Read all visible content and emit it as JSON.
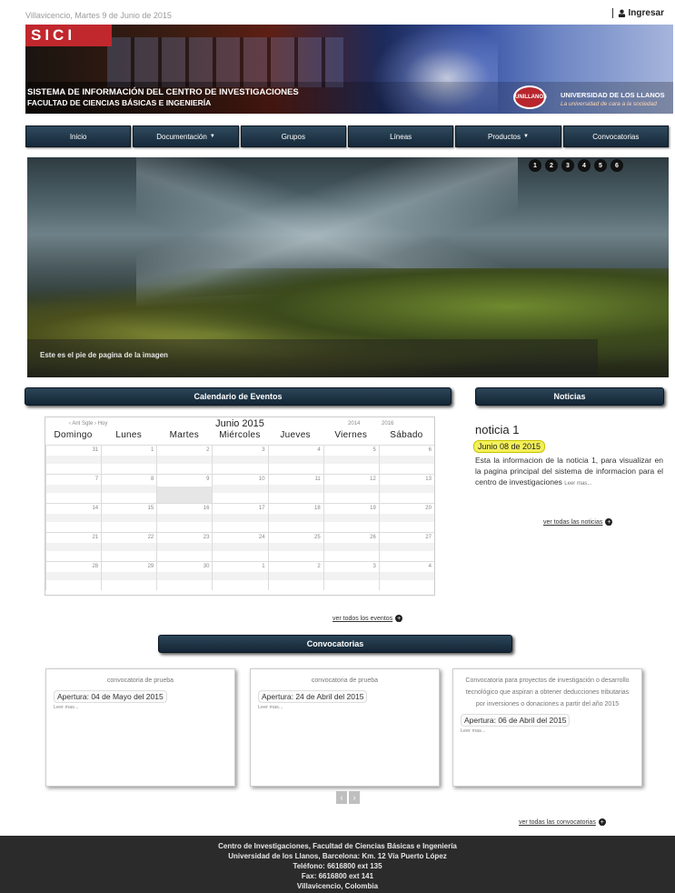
{
  "topbar": {
    "date": "Villavicencio, Martes 9 de Junio de 2015",
    "login_label": "Ingresar"
  },
  "banner": {
    "logo": "SICI",
    "title_line1": "SISTEMA DE INFORMACIÓN DEL CENTRO DE INVESTIGACIONES",
    "title_line2": "FACULTAD DE CIENCIAS BÁSICAS E INGENIERÍA",
    "university": "UNIVERSIDAD DE LOS LLANOS",
    "slogan": "La universidad de cara a la sociedad"
  },
  "nav": {
    "items": [
      {
        "label": "Inicio",
        "dropdown": false
      },
      {
        "label": "Documentación",
        "dropdown": true
      },
      {
        "label": "Grupos",
        "dropdown": false
      },
      {
        "label": "Líneas",
        "dropdown": false
      },
      {
        "label": "Productos",
        "dropdown": true
      },
      {
        "label": "Convocatorias",
        "dropdown": false
      }
    ]
  },
  "slider": {
    "caption": "Este es el pie de pagina de la imagen",
    "pages": [
      "1",
      "2",
      "3",
      "4",
      "5",
      "6"
    ]
  },
  "calendar": {
    "section_title": "Calendario de Eventos",
    "nav": "‹ Ant  Sgte › Hoy",
    "month_title": "Junio 2015",
    "year_prev": "2014",
    "year_next": "2016",
    "weekdays": [
      "Domingo",
      "Lunes",
      "Martes",
      "Miércoles",
      "Jueves",
      "Viernes",
      "Sábado"
    ],
    "days": [
      "31",
      "1",
      "2",
      "3",
      "4",
      "5",
      "6",
      "7",
      "8",
      "9",
      "10",
      "11",
      "12",
      "13",
      "14",
      "15",
      "16",
      "17",
      "18",
      "19",
      "20",
      "21",
      "22",
      "23",
      "24",
      "25",
      "26",
      "27",
      "28",
      "29",
      "30",
      "1",
      "2",
      "3",
      "4"
    ],
    "see_all": "ver todos los eventos"
  },
  "news": {
    "section_title": "Noticias",
    "title": "noticia 1",
    "date": "Junio 08 de 2015",
    "body": "Esta la informacion de la noticia 1, para visualizar en la pagina principal del sistema de informacion para el centro de investigaciones",
    "read_more": "Leer mas...",
    "see_all": "ver todas las noticias"
  },
  "convocatorias": {
    "section_title": "Convocatorias",
    "cards": [
      {
        "title": "convocatoria de prueba",
        "opening": "Apertura: 04 de Mayo del 2015",
        "read_more": "Leer mas..."
      },
      {
        "title": "convocatoria de prueba",
        "opening": "Apertura: 24 de Abril del 2015",
        "read_more": "Leer mas..."
      },
      {
        "title": "Convocatoria para proyectos de investigación o desarrollo tecnológico que aspiran a obtener deducciones tributarias por inversiones o donaciones a partir del año 2015",
        "opening": "Apertura: 06 de Abril del 2015",
        "read_more": "Leer mas..."
      }
    ],
    "prev_glyph": "‹",
    "next_glyph": "›",
    "see_all": "ver todas las convocatorias"
  },
  "footer": {
    "lines": [
      "Centro de Investigaciones, Facultad de Ciencias Básicas e Ingeniería",
      "Universidad de los Llanos, Barcelona: Km. 12 Vía Puerto López",
      "Teléfono: 6616800 ext 135",
      "Fax: 6616800 ext 141",
      "Villavicencio, Colombia"
    ]
  }
}
